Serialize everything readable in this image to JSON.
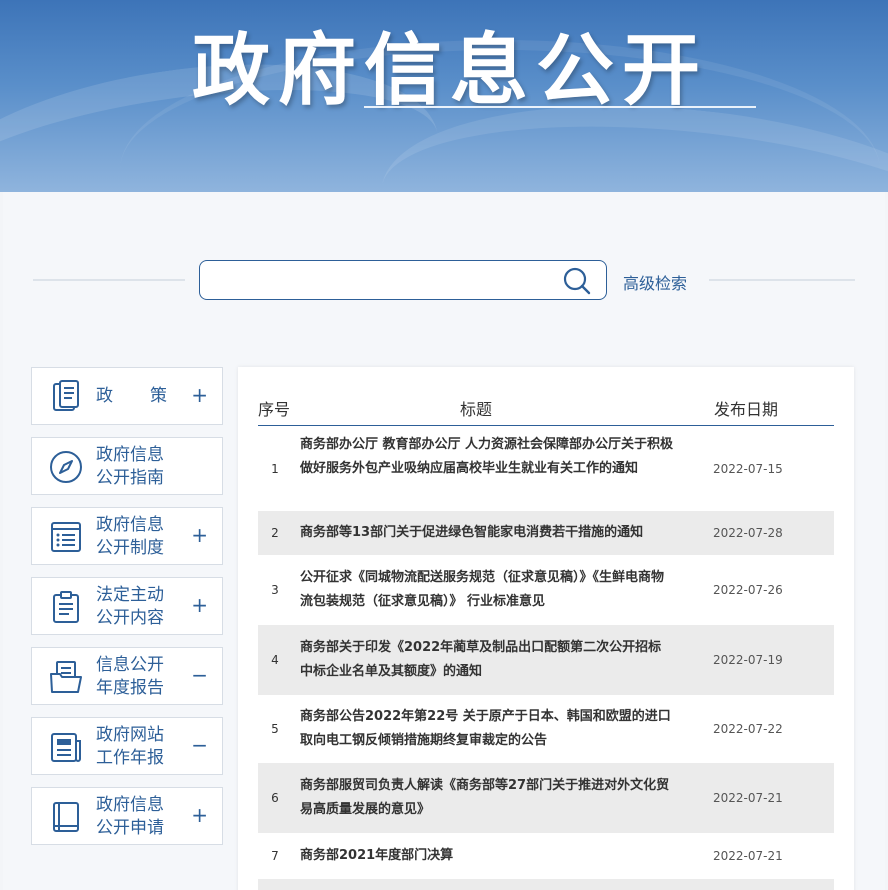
{
  "banner": {
    "title": "政府信息公开"
  },
  "search": {
    "placeholder": "",
    "advanced_label": "高级检索"
  },
  "nav": [
    {
      "label": "政　　策",
      "icon": "policy-book-icon",
      "toggle": "+"
    },
    {
      "label": "政府信息公开指南",
      "icon": "compass-icon",
      "toggle": ""
    },
    {
      "label": "政府信息公开制度",
      "icon": "list-document-icon",
      "toggle": "+"
    },
    {
      "label": "法定主动公开内容",
      "icon": "clipboard-icon",
      "toggle": "+"
    },
    {
      "label": "信息公开年度报告",
      "icon": "folder-report-icon",
      "toggle": "−"
    },
    {
      "label": "政府网站工作年报",
      "icon": "newspaper-icon",
      "toggle": "−"
    },
    {
      "label": "政府信息公开申请",
      "icon": "notebook-icon",
      "toggle": "+"
    }
  ],
  "table": {
    "headers": {
      "no": "序号",
      "title": "标题",
      "date": "发布日期"
    },
    "rows": [
      {
        "no": "1",
        "title": "商务部办公厅 教育部办公厅 人力资源社会保障部办公厅关于积极做好服务外包产业吸纳应届高校毕业生就业有关工作的通知",
        "date": "2022-07-15"
      },
      {
        "no": "2",
        "title": "商务部等13部门关于促进绿色智能家电消费若干措施的通知",
        "date": "2022-07-28"
      },
      {
        "no": "3",
        "title": "公开征求《同城物流配送服务规范（征求意见稿）》《生鲜电商物流包装规范（征求意见稿）》 行业标准意见",
        "date": "2022-07-26"
      },
      {
        "no": "4",
        "title": "商务部关于印发《2022年蔺草及制品出口配额第二次公开招标中标企业名单及其额度》的通知",
        "date": "2022-07-19"
      },
      {
        "no": "5",
        "title": "商务部公告2022年第22号 关于原产于日本、韩国和欧盟的进口取向电工钢反倾销措施期终复审裁定的公告",
        "date": "2022-07-22"
      },
      {
        "no": "6",
        "title": "商务部服贸司负责人解读《商务部等27部门关于推进对外文化贸易高质量发展的意见》",
        "date": "2022-07-21"
      },
      {
        "no": "7",
        "title": "商务部2021年度部门决算",
        "date": "2022-07-21"
      }
    ]
  },
  "colors": {
    "brand": "#2d5f98",
    "banner": "#4a80c2",
    "alt_row": "#ebebeb"
  }
}
